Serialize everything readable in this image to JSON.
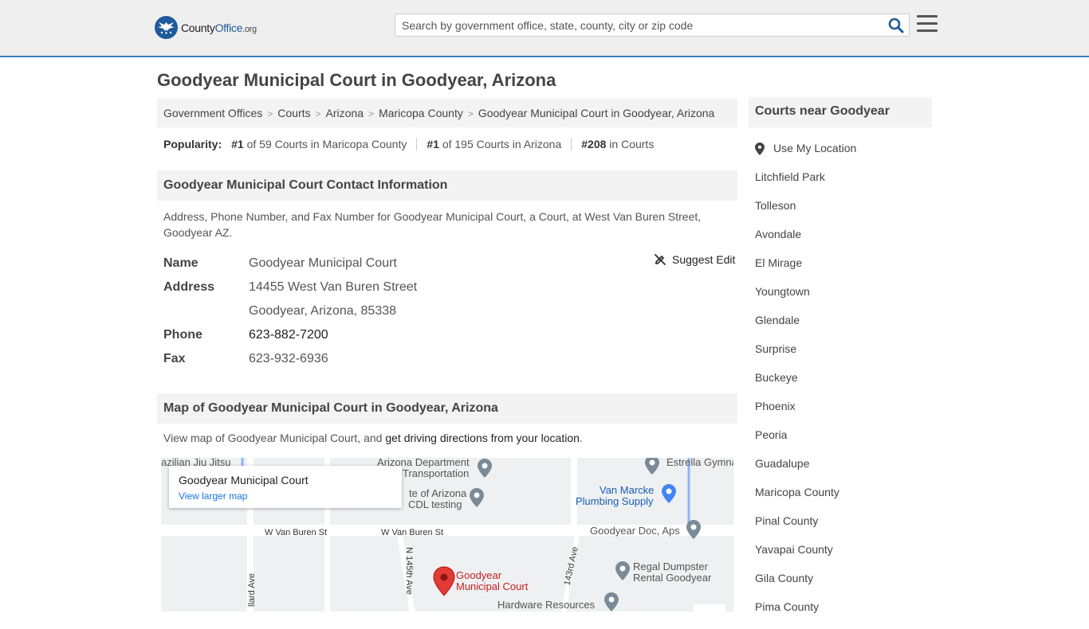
{
  "header": {
    "logo": {
      "county": "County",
      "office": "Office",
      "org": ".org"
    },
    "search_placeholder": "Search by government office, state, county, city or zip code"
  },
  "page_title": "Goodyear Municipal Court in Goodyear, Arizona",
  "breadcrumb": [
    "Government Offices",
    "Courts",
    "Arizona",
    "Maricopa County",
    "Goodyear Municipal Court in Goodyear, Arizona"
  ],
  "popularity": {
    "label": "Popularity:",
    "items": [
      {
        "rank": "#1",
        "text": "of 59 Courts in Maricopa County"
      },
      {
        "rank": "#1",
        "text": "of 195 Courts in Arizona"
      },
      {
        "rank": "#208",
        "text": "in Courts"
      }
    ]
  },
  "contact": {
    "heading": "Goodyear Municipal Court Contact Information",
    "description": "Address, Phone Number, and Fax Number for Goodyear Municipal Court, a Court, at West Van Buren Street, Goodyear AZ.",
    "suggest_edit": "Suggest Edit",
    "name_label": "Name",
    "name": "Goodyear Municipal Court",
    "address_label": "Address",
    "address_line1": "14455 West Van Buren Street",
    "address_line2": "Goodyear, Arizona, 85338",
    "phone_label": "Phone",
    "phone": "623-882-7200",
    "fax_label": "Fax",
    "fax": "623-932-6936"
  },
  "map_section": {
    "heading": "Map of Goodyear Municipal Court in Goodyear, Arizona",
    "desc_prefix": "View map of Goodyear Municipal Court, and ",
    "desc_link": "get driving directions from your location",
    "desc_suffix": ".",
    "card_title": "Goodyear Municipal Court",
    "card_link": "View larger map",
    "labels": {
      "jiu_jitsu": "azilian Jiu Jitsu",
      "az_dept_1": "Arizona Department",
      "az_dept_2": "Transportation",
      "estrella": "Estrella Gymna",
      "state_az_1": "te of Arizona",
      "state_az_2": "CDL testing",
      "van_marcke_1": "Van Marcke",
      "van_marcke_2": "Plumbing Supply",
      "van_buren_1": "W Van Buren St",
      "van_buren_2": "W Van Buren St",
      "goodyear_doc": "Goodyear Doc, Aps",
      "n145": "N 145th Ave",
      "n143": "143rd Ave",
      "court_1": "Goodyear",
      "court_2": "Municipal Court",
      "regal_1": "Regal Dumpster",
      "regal_2": "Rental Goodyear",
      "hardware": "Hardware Resources",
      "dillard": "llard Ave"
    }
  },
  "sidebar": {
    "heading": "Courts near Goodyear",
    "use_location": "Use My Location",
    "items": [
      "Litchfield Park",
      "Tolleson",
      "Avondale",
      "El Mirage",
      "Youngtown",
      "Glendale",
      "Surprise",
      "Buckeye",
      "Phoenix",
      "Peoria",
      "Guadalupe",
      "Maricopa County",
      "Pinal County",
      "Yavapai County",
      "Gila County",
      "Pima County"
    ]
  }
}
